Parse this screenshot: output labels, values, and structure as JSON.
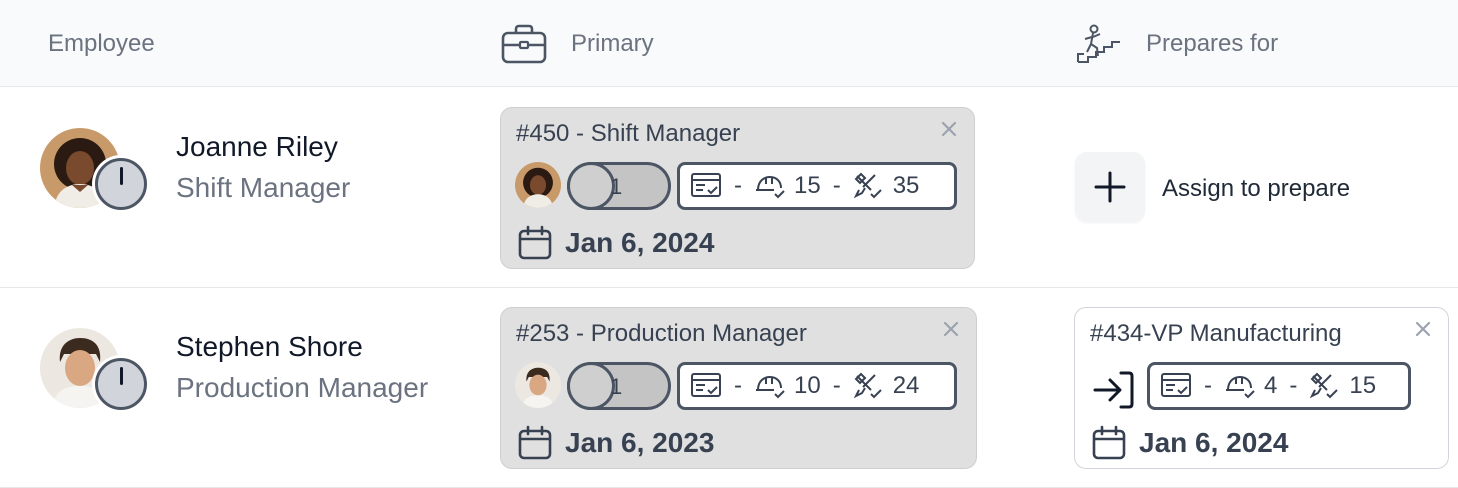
{
  "header": {
    "employee": "Employee",
    "primary": "Primary",
    "prepares_for": "Prepares for"
  },
  "rows": [
    {
      "name": "Joanne Riley",
      "role": "Shift Manager",
      "primary": {
        "title": "#450 - Shift Manager",
        "count": "1",
        "stat_a": "-",
        "stat_b": "15",
        "stat_c": "35",
        "date": "Jan 6, 2024"
      },
      "prepares": {
        "assign_label": "Assign to prepare"
      }
    },
    {
      "name": "Stephen Shore",
      "role": "Production Manager",
      "primary": {
        "title": "#253 - Production Manager",
        "count": "1",
        "stat_a": "-",
        "stat_b": "10",
        "stat_c": "24",
        "date": "Jan 6, 2023"
      },
      "prepares": {
        "title": "#434-VP Manufacturing",
        "stat_a": "-",
        "stat_b": "4",
        "stat_c": "15",
        "date": "Jan 6, 2024"
      }
    }
  ],
  "icons": {
    "primary_header": "briefcase-icon",
    "prepares_header": "climbing-stairs-icon",
    "close": "close-icon",
    "calendar": "calendar-icon",
    "plus": "plus-icon",
    "stat_1": "task-list-icon",
    "stat_2": "hardhat-check-icon",
    "stat_3": "tools-check-icon",
    "enter": "arrow-right-to-bracket-icon"
  },
  "colors": {
    "header_bg": "#f9fafb",
    "card_gray": "#e0e0e0",
    "border_dark": "#4b5563",
    "muted_text": "#6b7280"
  }
}
